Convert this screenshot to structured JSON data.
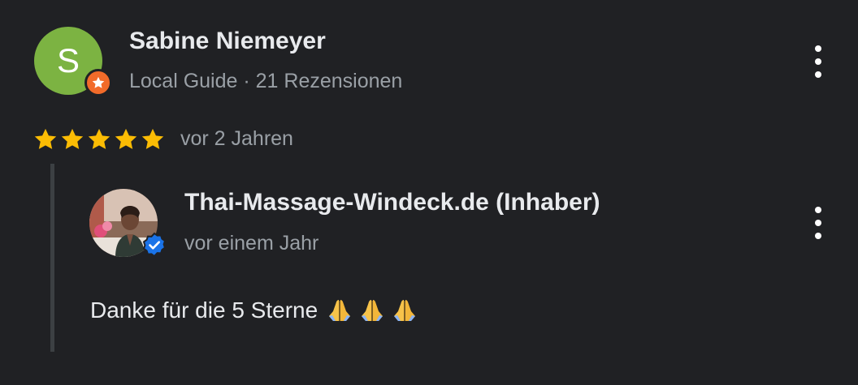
{
  "review": {
    "reviewer": {
      "avatar_letter": "S",
      "avatar_color": "#7cb342",
      "name": "Sabine Niemeyer",
      "meta": "Local Guide · 21 Rezensionen",
      "badge_icon": "local-guide-star-icon",
      "badge_color": "#f26b2a"
    },
    "rating": 5,
    "rating_max": 5,
    "star_color": "#fbbc04",
    "date": "vor 2 Jahren",
    "menu_icon": "more-vert-icon"
  },
  "owner_reply": {
    "name": "Thai-Massage-Windeck.de (Inhaber)",
    "date": "vor einem Jahr",
    "text": "Danke für die 5 Sterne",
    "emoji_icons": [
      "folded-hands-icon",
      "folded-hands-icon",
      "folded-hands-icon"
    ],
    "verified_icon": "verified-badge-icon",
    "verified_color": "#1a73e8",
    "menu_icon": "more-vert-icon"
  }
}
